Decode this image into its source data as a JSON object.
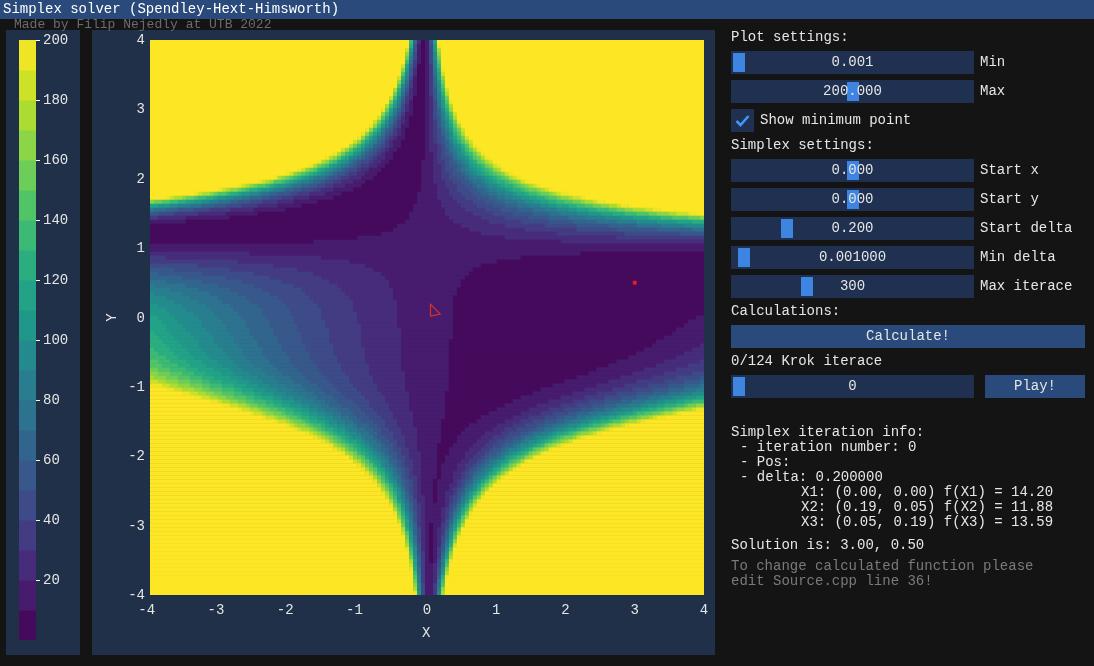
{
  "window": {
    "title": "Simplex solver (Spendley-Hext-Himsworth)"
  },
  "credit": "Made by Filip Nejedly at UTB 2022",
  "colorbar": {
    "ticks": [
      "200",
      "180",
      "160",
      "140",
      "120",
      "100",
      "80",
      "60",
      "40",
      "20"
    ]
  },
  "plot": {
    "x_ticks": [
      "-4",
      "-3",
      "-2",
      "-1",
      "0",
      "1",
      "2",
      "3",
      "4"
    ],
    "y_ticks": [
      "4",
      "3",
      "2",
      "1",
      "0",
      "-1",
      "-2",
      "-3",
      "-4"
    ],
    "x_label": "X",
    "y_label": "Y"
  },
  "plot_settings": {
    "heading": "Plot settings:",
    "sliders": [
      {
        "value": "0.001",
        "label": "Min",
        "level": 0.0
      },
      {
        "value": "200.000",
        "label": "Max",
        "level": 0.5
      }
    ],
    "checkbox": {
      "label": "Show minimum point",
      "checked": true
    }
  },
  "simplex_settings": {
    "heading": "Simplex settings:",
    "sliders": [
      {
        "value": "0.000",
        "label": "Start x",
        "level": 0.5
      },
      {
        "value": "0.000",
        "label": "Start y",
        "level": 0.5
      },
      {
        "value": "0.200",
        "label": "Start delta",
        "level": 0.21
      },
      {
        "value": "0.001000",
        "label": "Min delta",
        "level": 0.02
      },
      {
        "value": "300",
        "label": "Max iterace",
        "level": 0.3
      }
    ]
  },
  "calculations": {
    "heading": "Calculations:",
    "button": "Calculate!",
    "step_label": "0/124 Krok iterace",
    "step_slider": {
      "value": "0",
      "level": 0.0
    },
    "play_button": "Play!"
  },
  "info": {
    "heading": "Simplex iteration info:",
    "lines": [
      {
        "kind": "bullet",
        "text": "- iteration number: 0"
      },
      {
        "kind": "bullet",
        "text": "- Pos:"
      },
      {
        "kind": "bullet",
        "text": "- delta: 0.200000"
      },
      {
        "kind": "point",
        "text": "X1: (0.00, 0.00) f(X1) = 14.20"
      },
      {
        "kind": "point",
        "text": "X2: (0.19, 0.05) f(X2) = 11.88"
      },
      {
        "kind": "point",
        "text": "X3: (0.05, 0.19) f(X3) = 13.59"
      }
    ],
    "solution": "Solution is: 3.00, 0.50",
    "hint": "To change calculated function please edit Source.cpp line 36!"
  }
}
